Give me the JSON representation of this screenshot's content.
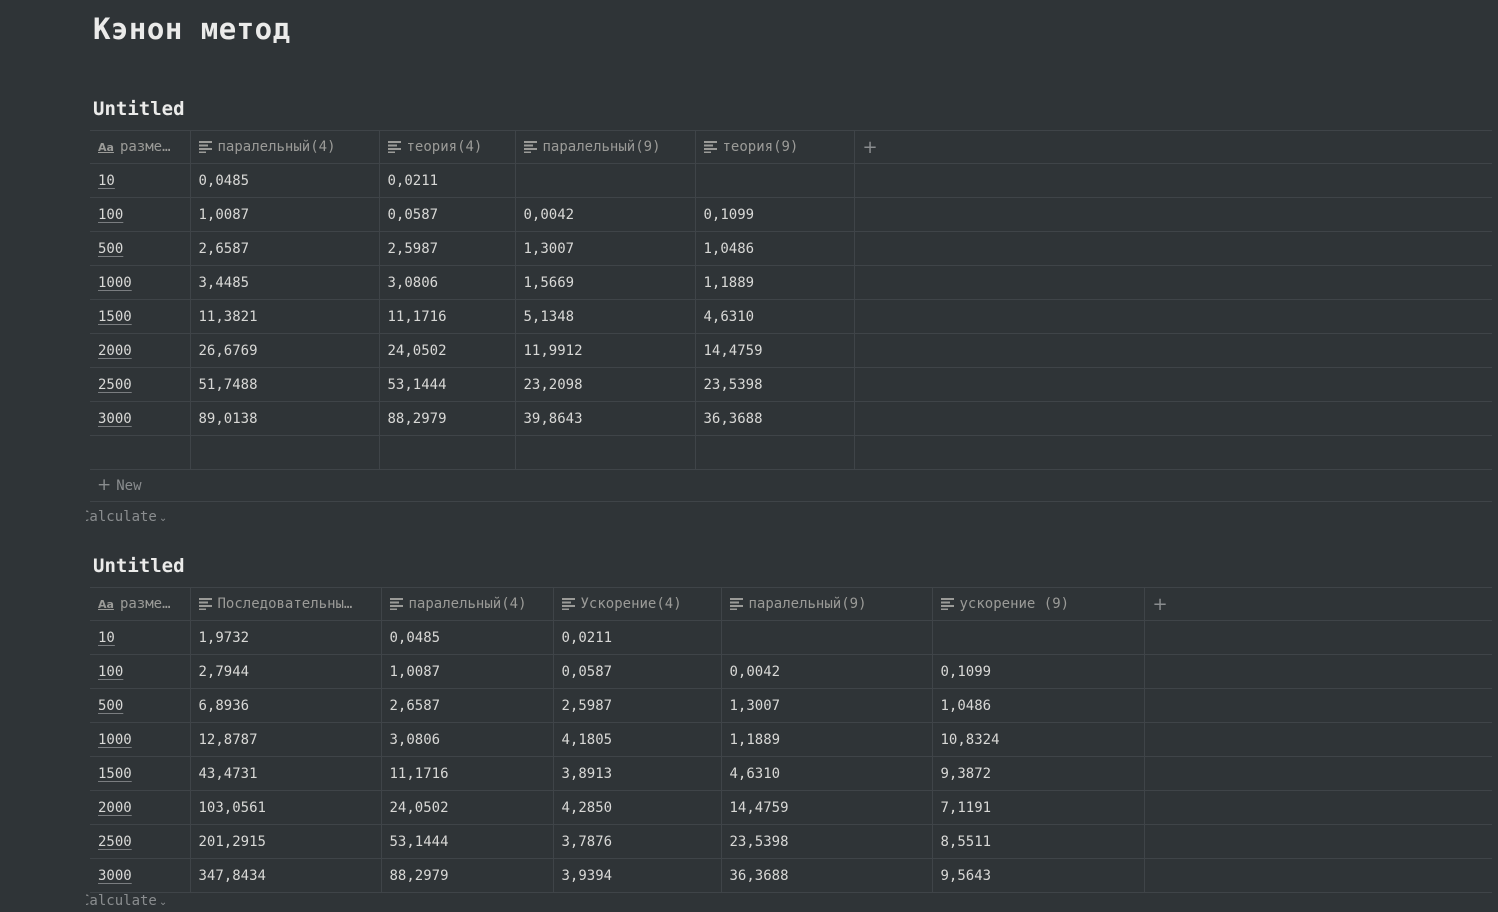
{
  "page": {
    "title": "Кэнон метод"
  },
  "table1": {
    "title": "Untitled",
    "columns": [
      "разме…",
      "паралельный(4)",
      "теория(4)",
      "паралельный(9)",
      "теория(9)"
    ],
    "rows": [
      [
        "10",
        "0,0485",
        "0,0211",
        "",
        ""
      ],
      [
        "100",
        "1,0087",
        "0,0587",
        "0,0042",
        "0,1099"
      ],
      [
        "500",
        "2,6587",
        "2,5987",
        "1,3007",
        "1,0486"
      ],
      [
        "1000",
        "3,4485",
        "3,0806",
        "1,5669",
        "1,1889"
      ],
      [
        "1500",
        "11,3821",
        "11,1716",
        "5,1348",
        "4,6310"
      ],
      [
        "2000",
        "26,6769",
        "24,0502",
        "11,9912",
        "14,4759"
      ],
      [
        "2500",
        "51,7488",
        "53,1444",
        "23,2098",
        "23,5398"
      ],
      [
        "3000",
        "89,0138",
        "88,2979",
        "39,8643",
        "36,3688"
      ],
      [
        "",
        "",
        "",
        "",
        ""
      ]
    ],
    "new_label": "New",
    "calculate_label": "Calculate"
  },
  "table2": {
    "title": "Untitled",
    "columns": [
      "разме…",
      "Последовательны…",
      "паралельный(4)",
      "Ускорение(4)",
      "паралельный(9)",
      "ускорение (9)"
    ],
    "rows": [
      [
        "10",
        "1,9732",
        "0,0485",
        "0,0211",
        "",
        ""
      ],
      [
        "100",
        "2,7944",
        "1,0087",
        "0,0587",
        "0,0042",
        "0,1099"
      ],
      [
        "500",
        "6,8936",
        "2,6587",
        "2,5987",
        "1,3007",
        "1,0486"
      ],
      [
        "1000",
        "12,8787",
        "3,0806",
        "4,1805",
        "1,1889",
        "10,8324"
      ],
      [
        "1500",
        "43,4731",
        "11,1716",
        "3,8913",
        "4,6310",
        "9,3872"
      ],
      [
        "2000",
        "103,0561",
        "24,0502",
        "4,2850",
        "14,4759",
        "7,1191"
      ],
      [
        "2500",
        "201,2915",
        "53,1444",
        "3,7876",
        "23,5398",
        "8,5511"
      ],
      [
        "3000",
        "347,8434",
        "88,2979",
        "3,9394",
        "36,3688",
        "9,5643"
      ]
    ],
    "calculate_label": "Calculate"
  },
  "icons": {
    "title_column": "Aa-icon",
    "text_column": "text-lines-icon",
    "add_column": "plus-icon",
    "calculate": "chevron-down-icon"
  },
  "colors": {
    "background": "#2f3437",
    "text": "#e6e6e5",
    "muted": "#9b9b98",
    "border": "#3f4448"
  }
}
